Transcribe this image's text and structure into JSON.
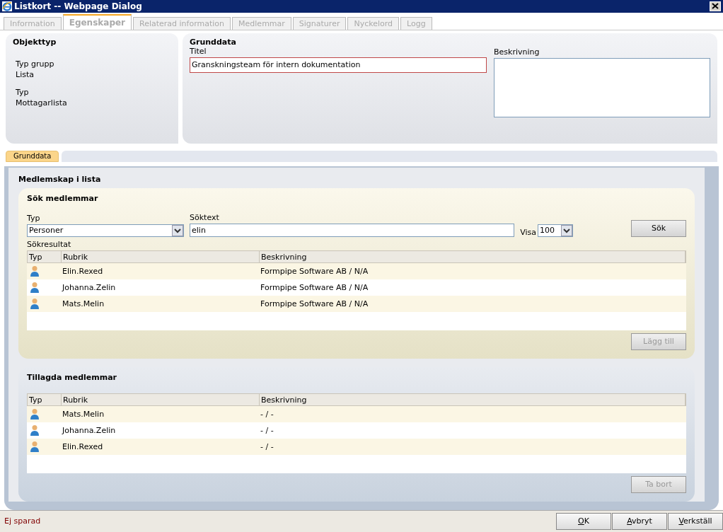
{
  "window": {
    "title": "Listkort -- Webpage Dialog"
  },
  "tabs": [
    {
      "label": "Information",
      "selected": false
    },
    {
      "label": "Egenskaper",
      "selected": true
    },
    {
      "label": "Relaterad information",
      "selected": false
    },
    {
      "label": "Medlemmar",
      "selected": false
    },
    {
      "label": "Signaturer",
      "selected": false
    },
    {
      "label": "Nyckelord",
      "selected": false
    },
    {
      "label": "Logg",
      "selected": false
    }
  ],
  "objekttyp": {
    "heading": "Objekttyp",
    "fields": [
      {
        "label": "Typ grupp",
        "value": "Lista"
      },
      {
        "label": "Typ",
        "value": "Mottagarlista"
      }
    ]
  },
  "grunddata": {
    "heading": "Grunddata",
    "title_label": "Titel",
    "title_value": "Granskningsteam för intern dokumentation",
    "description_label": "Beskrivning"
  },
  "subtabs": [
    {
      "label": "Grunddata",
      "selected": true
    }
  ],
  "membership": {
    "heading": "Medlemskap i lista",
    "search": {
      "heading": "Sök medlemmar",
      "type_label": "Typ",
      "type_value": "Personer",
      "text_label": "Söktext",
      "text_value": "elin",
      "show_label": "Visa",
      "show_value": "100",
      "search_button": "Sök",
      "results_label": "Sökresultat",
      "columns": [
        "Typ",
        "Rubrik",
        "Beskrivning"
      ],
      "rows": [
        {
          "rubrik": "Elin.Rexed",
          "beskrivning": "Formpipe Software AB / N/A"
        },
        {
          "rubrik": "Johanna.Zelin",
          "beskrivning": "Formpipe Software AB / N/A"
        },
        {
          "rubrik": "Mats.Melin",
          "beskrivning": "Formpipe Software AB / N/A"
        }
      ],
      "add_button": {
        "label": "Lägg till",
        "disabled": true
      }
    },
    "added": {
      "heading": "Tillagda medlemmar",
      "columns": [
        "Typ",
        "Rubrik",
        "Beskrivning"
      ],
      "rows": [
        {
          "rubrik": "Mats.Melin",
          "beskrivning": "- / -"
        },
        {
          "rubrik": "Johanna.Zelin",
          "beskrivning": "- / -"
        },
        {
          "rubrik": "Elin.Rexed",
          "beskrivning": "- / -"
        }
      ],
      "remove_button": {
        "label": "Ta bort",
        "disabled": true
      }
    }
  },
  "status_bar": {
    "text": "Ej sparad",
    "buttons": [
      "OK",
      "Avbryt",
      "Verkställ"
    ]
  }
}
